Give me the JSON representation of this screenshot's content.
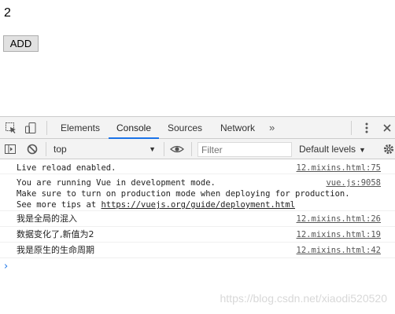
{
  "page": {
    "counter_value": "2",
    "add_button_label": "ADD"
  },
  "devtools": {
    "tabs": [
      {
        "label": "Elements",
        "active": false
      },
      {
        "label": "Console",
        "active": true
      },
      {
        "label": "Sources",
        "active": false
      },
      {
        "label": "Network",
        "active": false
      }
    ],
    "more_tabs_glyph": "»",
    "context_selector": "top",
    "filter_placeholder": "Filter",
    "levels_label": "Default levels",
    "messages": [
      {
        "lines": [
          "Live reload enabled."
        ],
        "source": "12.mixins.html:75",
        "cjk": false
      },
      {
        "lines": [
          "You are running Vue in development mode.",
          "Make sure to turn on production mode when deploying for production.",
          "See more tips at "
        ],
        "link_text": "https://vuejs.org/guide/deployment.html",
        "source": "vue.js:9058",
        "cjk": false
      },
      {
        "lines": [
          "我是全局的混入"
        ],
        "source": "12.mixins.html:26",
        "cjk": true
      },
      {
        "lines": [
          "数据变化了,新值为2"
        ],
        "source": "12.mixins.html:19",
        "cjk": true
      },
      {
        "lines": [
          "我是原生的生命周期"
        ],
        "source": "12.mixins.html:42",
        "cjk": true
      }
    ],
    "prompt_glyph": "›"
  },
  "watermark": "https://blog.csdn.net/xiaodi520520",
  "colors": {
    "accent": "#1a73e8",
    "panel_bg": "#f3f3f3",
    "border": "#cbcbcb"
  }
}
